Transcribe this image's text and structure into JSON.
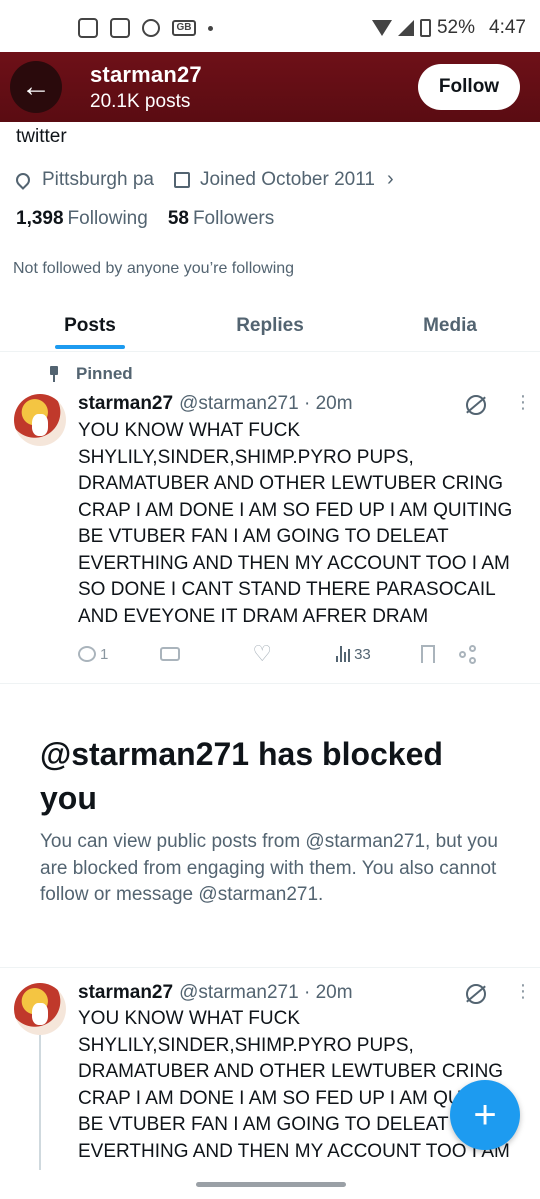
{
  "status_bar": {
    "battery": "52%",
    "time": "4:47",
    "icons": [
      "twitch-icon",
      "twitch-icon",
      "reddit-icon",
      "gb-icon",
      "dot-icon",
      "wifi-icon",
      "signal-icon",
      "battery-icon"
    ]
  },
  "header": {
    "name": "starman27",
    "posts_count": "20.1K posts",
    "follow_label": "Follow"
  },
  "profile": {
    "bio_tail": "twitter",
    "location": "Pittsburgh pa",
    "joined": "Joined October 2011",
    "following_count": "1,398",
    "following_label": "Following",
    "followers_count": "58",
    "followers_label": "Followers",
    "not_followed": "Not followed by anyone you’re following"
  },
  "tabs": [
    {
      "label": "Posts",
      "active": true
    },
    {
      "label": "Replies",
      "active": false
    },
    {
      "label": "Media",
      "active": false
    }
  ],
  "pinned_post": {
    "pinned_label": "Pinned",
    "display_name": "starman27",
    "handle": "@starman271",
    "time": "· 20m",
    "lines": [
      "YOU KNOW WHAT FUCK",
      "SHYLILY,SINDER,SHIMP.PYRO PUPS,",
      "DRAMATUBER AND OTHER LEWTUBER CRING",
      "CRAP I AM DONE I AM SO FED UP I AM QUITING",
      "BE VTUBER FAN I AM GOING TO DELEAT",
      "EVERTHING AND THEN MY ACCOUNT TOO I AM",
      "SO DONE I CANT STAND THERE PARASOCAIL",
      "AND EVEYONE IT DRAM AFRER DRAM"
    ],
    "reply_count": "1",
    "views": "33"
  },
  "blocked": {
    "title": "@starman271 has blocked you",
    "description": "You can view public posts from @starman271, but you are blocked from engaging with them. You also cannot follow or message @starman271."
  },
  "second_post": {
    "display_name": "starman27",
    "handle": "@starman271",
    "time": "· 20m",
    "lines": [
      "YOU KNOW WHAT FUCK",
      "SHYLILY,SINDER,SHIMP.PYRO PUPS,",
      "DRAMATUBER AND OTHER LEWTUBER CRING",
      "CRAP I AM DONE I AM SO FED UP I AM QUITING",
      "BE VTUBER FAN I AM GOING TO DELEAT",
      "EVERTHING AND THEN MY ACCOUNT TOO I AM"
    ]
  },
  "fab": {
    "label": "+"
  }
}
